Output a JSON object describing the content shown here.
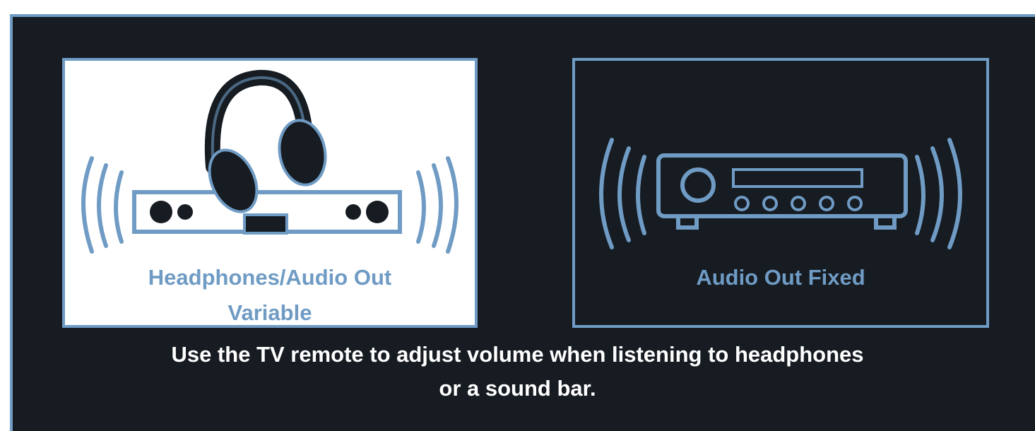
{
  "options": [
    {
      "label_line1": "Headphones/Audio Out",
      "label_line2": "Variable",
      "icon": "headphones-soundbar-icon",
      "selected": true
    },
    {
      "label_line1": "Audio Out Fixed",
      "icon": "audio-receiver-icon",
      "selected": false
    }
  ],
  "hint": {
    "line1": "Use the TV remote to adjust volume when listening to headphones",
    "line2": "or a sound bar."
  },
  "colors": {
    "background": "#161c22",
    "accent": "#6f9bc4",
    "selected_bg": "#ffffff",
    "text": "#ffffff"
  }
}
